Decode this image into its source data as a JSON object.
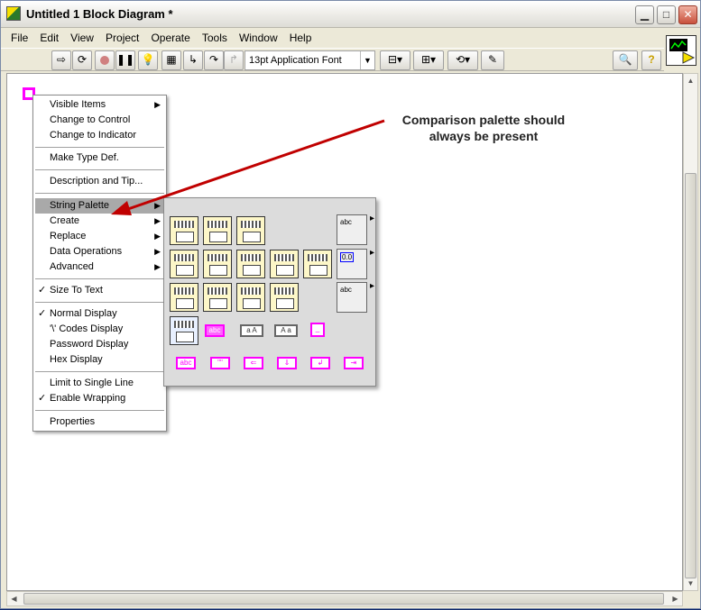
{
  "window": {
    "title": "Untitled 1 Block Diagram *",
    "minimize_glyph": "▁",
    "maximize_glyph": "□",
    "close_glyph": "✕"
  },
  "menubar": {
    "items": [
      {
        "label": "File"
      },
      {
        "label": "Edit"
      },
      {
        "label": "View"
      },
      {
        "label": "Project"
      },
      {
        "label": "Operate"
      },
      {
        "label": "Tools"
      },
      {
        "label": "Window"
      },
      {
        "label": "Help"
      }
    ]
  },
  "toolbar": {
    "font_select_value": "13pt Application Font",
    "icons": [
      "run-arrow-icon",
      "run-continuously-icon",
      "abort-icon",
      "pause-icon",
      "highlight-execution-icon",
      "retain-wire-values-icon",
      "step-into-icon",
      "step-over-icon",
      "step-out-icon",
      "align-objects-icon",
      "distribute-objects-icon",
      "reorder-icon",
      "clean-up-diagram-icon",
      "search-icon",
      "help-icon"
    ]
  },
  "context_menu": {
    "items": [
      {
        "label": "Visible Items",
        "submenu": true
      },
      {
        "label": "Change to Control"
      },
      {
        "label": "Change to Indicator"
      },
      {
        "label": "Make Type Def."
      },
      {
        "label": "Description and Tip..."
      },
      {
        "label": "String Palette",
        "submenu": true,
        "highlighted": true
      },
      {
        "label": "Create",
        "submenu": true
      },
      {
        "label": "Replace",
        "submenu": true
      },
      {
        "label": "Data Operations",
        "submenu": true
      },
      {
        "label": "Advanced",
        "submenu": true
      },
      {
        "label": "Size To Text",
        "checked": true
      },
      {
        "label": "Normal Display",
        "checked": true
      },
      {
        "label": "'\\' Codes Display"
      },
      {
        "label": "Password Display"
      },
      {
        "label": "Hex Display"
      },
      {
        "label": "Limit to Single Line"
      },
      {
        "label": "Enable Wrapping",
        "checked": true
      },
      {
        "label": "Properties"
      }
    ],
    "check_glyph": "✓",
    "submenu_glyph": "▶"
  },
  "palette": {
    "small_labels": [
      "abc",
      "abc",
      "\"\"",
      "a",
      "a"
    ],
    "sub_palette_labels": [
      "abc",
      "0.0",
      "abc"
    ]
  },
  "annotation": {
    "line1": "Comparison palette should",
    "line2": "always be present",
    "color": "#c00000"
  }
}
